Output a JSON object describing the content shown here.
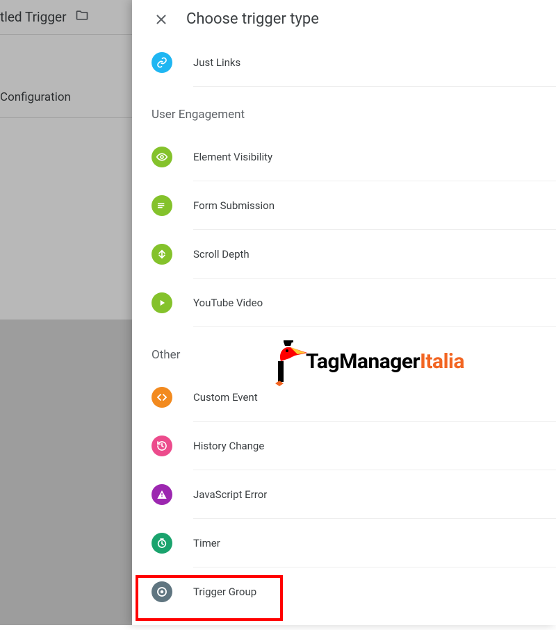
{
  "background": {
    "title_partial": "tled Trigger",
    "config_label": "Configuration"
  },
  "panel": {
    "title": "Choose trigger type",
    "first_visible_item": {
      "label": "Just Links"
    },
    "sections": [
      {
        "title": "User Engagement",
        "items": [
          {
            "label": "Element Visibility",
            "icon": "eye-icon",
            "color": "green"
          },
          {
            "label": "Form Submission",
            "icon": "form-icon",
            "color": "green"
          },
          {
            "label": "Scroll Depth",
            "icon": "scroll-icon",
            "color": "green"
          },
          {
            "label": "YouTube Video",
            "icon": "play-icon",
            "color": "green"
          }
        ]
      },
      {
        "title": "Other",
        "items": [
          {
            "label": "Custom Event",
            "icon": "code-icon",
            "color": "orange"
          },
          {
            "label": "History Change",
            "icon": "history-icon",
            "color": "pink"
          },
          {
            "label": "JavaScript Error",
            "icon": "warning-icon",
            "color": "purple"
          },
          {
            "label": "Timer",
            "icon": "clock-icon",
            "color": "teal"
          },
          {
            "label": "Trigger Group",
            "icon": "group-icon",
            "color": "grey",
            "highlighted": true
          }
        ]
      }
    ]
  },
  "watermark": {
    "text_part1": "TagManager",
    "text_part2": "Italia"
  }
}
